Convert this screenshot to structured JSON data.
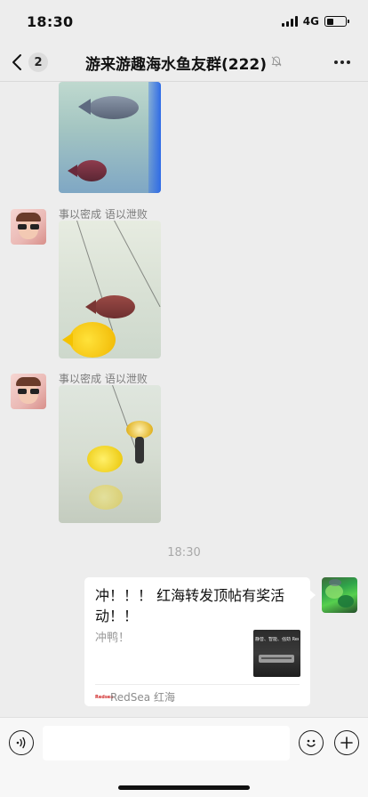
{
  "status_bar": {
    "time": "18:30",
    "network": "4G",
    "battery_level": 0.35
  },
  "nav": {
    "back_badge": "2",
    "title": "游来游趣海水鱼友群(222)",
    "back_icon": "chevron-left-icon",
    "mute_icon": "bell-off-icon",
    "more_icon": "ellipsis-icon"
  },
  "messages": [
    {
      "type": "image",
      "sender": "",
      "description": "fish-photo"
    },
    {
      "type": "image",
      "sender": "事以密成 语以泄败",
      "description": "fish-photo"
    },
    {
      "type": "image",
      "sender": "事以密成 语以泄败",
      "description": "fish-photo"
    }
  ],
  "time_divider": "18:30",
  "share_card": {
    "title": "冲！！！ 红海转发顶帖有奖活动！！",
    "description": "冲鸭！",
    "source": "RedSea 红海",
    "source_logo": "Redsea",
    "thumb_text": "静音、智能、强劲 ReefLED"
  },
  "input_bar": {
    "placeholder": "",
    "voice_icon": "voice-icon",
    "emoji_icon": "emoji-icon",
    "plus_icon": "plus-icon"
  }
}
